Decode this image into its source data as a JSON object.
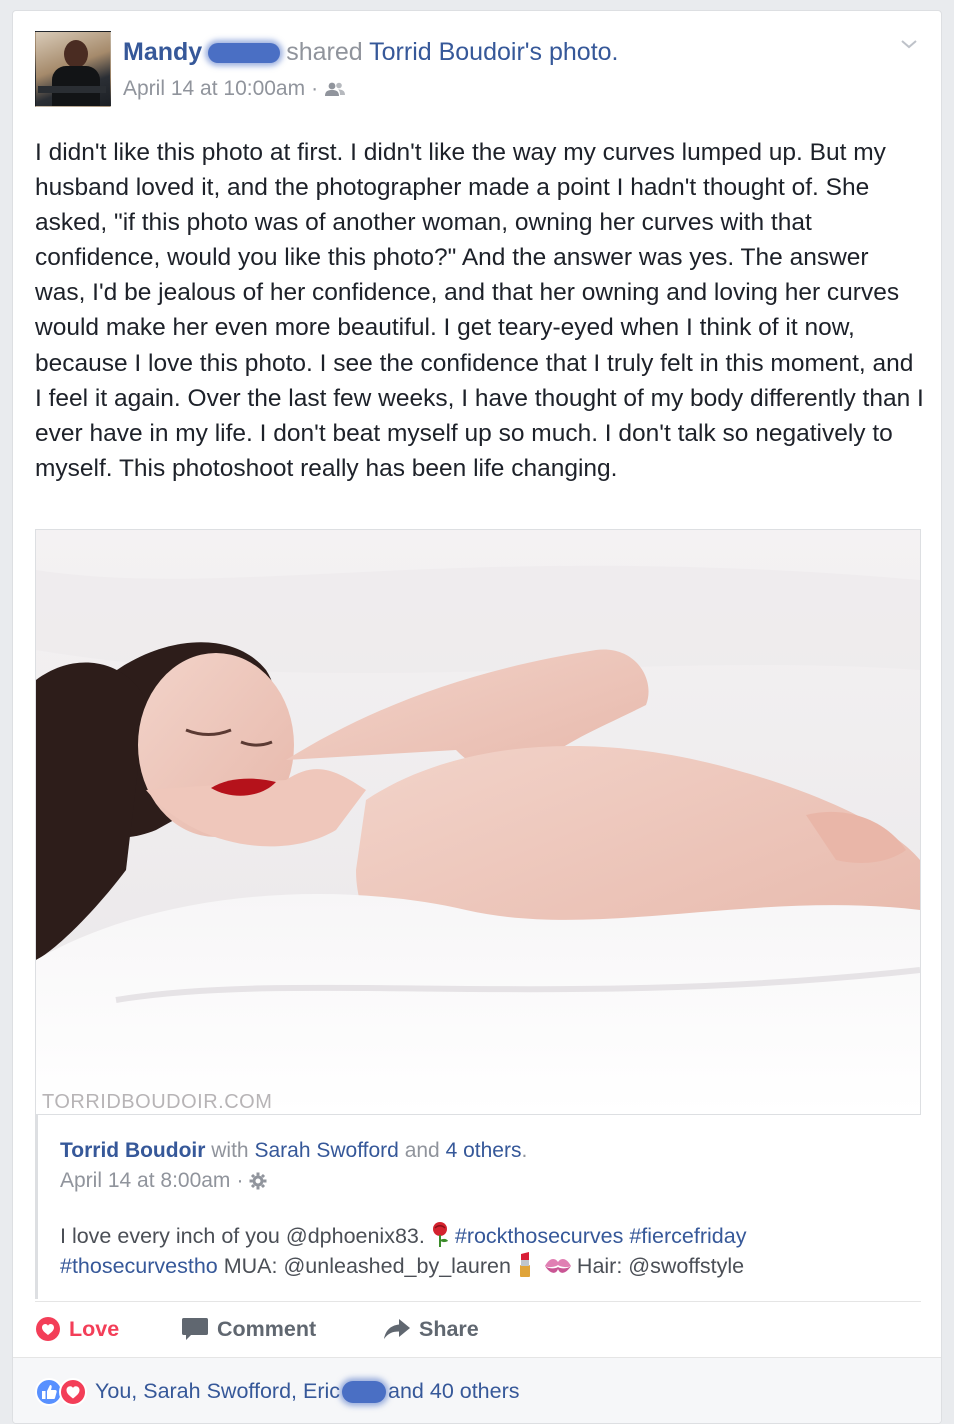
{
  "post": {
    "author_name": "Mandy",
    "shared_text": "shared",
    "shared_target": "Torrid Boudoir's photo.",
    "timestamp": "April 14 at 10:00am",
    "separator": "·",
    "audience_icon": "friends-icon",
    "body": [
      "I didn't like this photo at first. I didn't like the way my curves lumped up. But my husband loved it, and the photographer made a point I hadn't thought of. She asked, \"if this photo was of another woman, owning her curves with that confidence, would you like this photo?\" And the answer was yes. The answer was, I'd be jealous of her confidence, and that her owning and loving her curves would make her even more beautiful. I get teary-eyed when I think of it now, because I love this photo. I see the confidence that I truly felt in this moment, and I feel it again. Over the last few weeks, I have thought of my body differently than I ever have in my life. I don't beat myself up so much. I don't talk so negatively to myself. This photoshoot really has been life changing."
    ],
    "photo_watermark": "TORRIDBOUDOIR.COM"
  },
  "shared": {
    "page_name": "Torrid Boudoir",
    "with_text": "with",
    "tagged_person": "Sarah Swofford",
    "and_text": "and",
    "others_link": "4 others",
    "period": ".",
    "timestamp": "April 14 at 8:00am",
    "separator": "·",
    "audience_icon": "public-gear-icon",
    "caption_part1": "I love every inch of you @dphoenix83.",
    "hashtag1": "#rockthosecurves",
    "hashtag2": "#fiercefriday",
    "hashtag3": "#thosecurvestho",
    "caption_part2": "MUA: @unleashed_by_lauren",
    "caption_part3": "Hair: @swoffstyle"
  },
  "actions": {
    "love_label": "Love",
    "comment_label": "Comment",
    "share_label": "Share"
  },
  "reactions": {
    "text_before": "You, Sarah Swofford, Eric",
    "text_after": "and 40 others"
  },
  "colors": {
    "link": "#365899",
    "love": "#f33e58",
    "like": "#5890ff",
    "meta_gray": "#90949c"
  }
}
